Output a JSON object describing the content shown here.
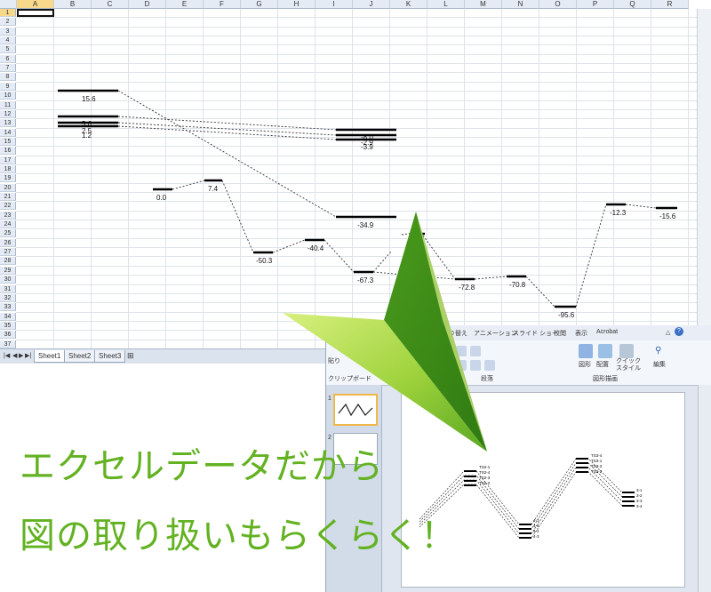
{
  "spreadsheet": {
    "columns": [
      "A",
      "B",
      "C",
      "D",
      "E",
      "F",
      "G",
      "H",
      "I",
      "J",
      "K",
      "L",
      "M",
      "N",
      "O",
      "P",
      "Q",
      "R"
    ],
    "rows": [
      "1",
      "2",
      "3",
      "4",
      "5",
      "6",
      "7",
      "8",
      "9",
      "10",
      "11",
      "12",
      "13",
      "14",
      "15",
      "16",
      "17",
      "18",
      "19",
      "20",
      "21",
      "22",
      "23",
      "24",
      "25",
      "26",
      "27",
      "28",
      "29",
      "30",
      "31",
      "32",
      "33",
      "34",
      "35",
      "36",
      "37"
    ],
    "selected_column": "A",
    "selected_row": "1",
    "sheets": [
      "Sheet1",
      "Sheet2",
      "Sheet3"
    ],
    "active_sheet": "Sheet1",
    "nav_icons": [
      "first-sheet-icon",
      "prev-sheet-icon",
      "next-sheet-icon",
      "last-sheet-icon"
    ]
  },
  "chart_data": {
    "type": "line",
    "levels": [
      {
        "label": "15.6",
        "value": 15.6,
        "col": "B-C"
      },
      {
        "label": "5.6",
        "value": 5.6,
        "col": "B-C"
      },
      {
        "label": "2.5",
        "value": 2.5,
        "col": "B-C"
      },
      {
        "label": "1.2",
        "value": 1.2,
        "col": "B-C"
      },
      {
        "label": "0.0",
        "value": 0.0,
        "col": "D"
      },
      {
        "label": "7.4",
        "value": 7.4,
        "col": "F"
      },
      {
        "label": "-50.3",
        "value": -50.3,
        "col": "G"
      },
      {
        "label": "-40.4",
        "value": -40.4,
        "col": "H"
      },
      {
        "label": "-34.9",
        "value": -34.9,
        "col": "I-J"
      },
      {
        "label": "-8.0",
        "value": -8.0,
        "col": "I-J"
      },
      {
        "label": "-2.9",
        "value": -2.9,
        "col": "I-J"
      },
      {
        "label": "-3.9",
        "value": -3.9,
        "col": "I-J"
      },
      {
        "label": "-67.3",
        "value": -67.3,
        "col": "I"
      },
      {
        "label": "-72.8",
        "value": -72.8,
        "col": "L"
      },
      {
        "label": "-70.8",
        "value": -70.8,
        "col": "N"
      },
      {
        "label": "-95.6",
        "value": -95.6,
        "col": "O"
      },
      {
        "label": "-12.3",
        "value": -12.3,
        "col": "P"
      },
      {
        "label": "-15.6",
        "value": -15.6,
        "col": "R"
      }
    ],
    "partial_label": "3"
  },
  "powerpoint": {
    "tabs": [
      "り替え",
      "アニメーション",
      "スライド ショー",
      "校閲",
      "表示",
      "Acrobat"
    ],
    "ribbon": {
      "paragraph_label": "段落",
      "drawing_label": "図形描画",
      "clipboard_label": "クリップボード",
      "paste_label": "貼り",
      "shape_label": "図形",
      "arrange_label": "配置",
      "quick_style_label": "クイック\nスタイル",
      "edit_label": "編集"
    },
    "slide_numbers": [
      "1",
      "2"
    ],
    "slide_labels": [
      "TS2-1",
      "TS2-4",
      "TS2-3",
      "TS2-2",
      "TS3-4",
      "TS3-1",
      "TS3-3",
      "TS3-2",
      "3-1",
      "3-2",
      "3-3",
      "3-4",
      "4-1",
      "4-4",
      "4-2",
      "4-3"
    ]
  },
  "tagline": {
    "line1": "エクセルデータだから",
    "line2": "図の取り扱いもらくらく！"
  },
  "colors": {
    "tagline": "#62b221",
    "arrow_light": "#c6e86a",
    "arrow_dark": "#3f8e1a"
  }
}
